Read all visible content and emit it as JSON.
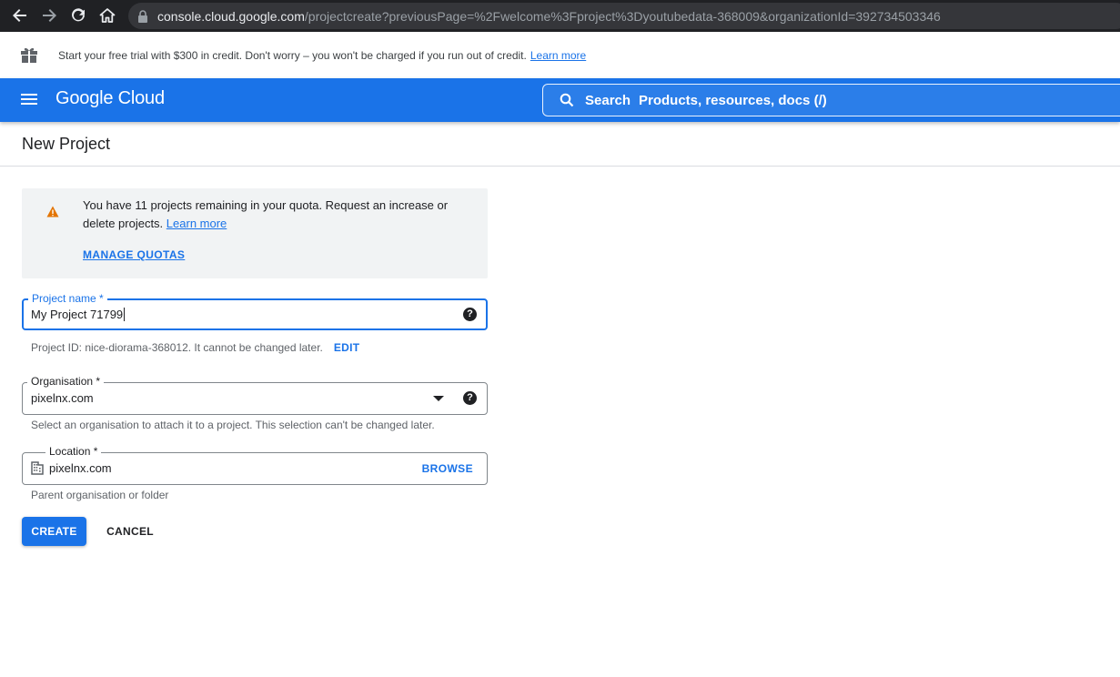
{
  "browser": {
    "url_host": "console.cloud.google.com",
    "url_path": "/projectcreate?previousPage=%2Fwelcome%3Fproject%3Dyoutubedata-368009&organizationId=392734503346"
  },
  "trial_banner": {
    "text": "Start your free trial with $300 in credit. Don't worry – you won't be charged if you run out of credit.",
    "link": "Learn more"
  },
  "header": {
    "logo": "Google Cloud",
    "search_label": "Search",
    "search_placeholder": "Products, resources, docs (/)"
  },
  "page": {
    "title": "New Project"
  },
  "quota_alert": {
    "text": "You have 11 projects remaining in your quota. Request an increase or delete projects.",
    "link": "Learn more",
    "manage_quotas": "MANAGE QUOTAS"
  },
  "form": {
    "project_name": {
      "label": "Project name *",
      "value": "My Project 71799",
      "helper": "Project ID: nice-diorama-368012. It cannot be changed later.",
      "edit": "EDIT"
    },
    "organisation": {
      "label": "Organisation *",
      "value": "pixelnx.com",
      "helper": "Select an organisation to attach it to a project. This selection can't be changed later."
    },
    "location": {
      "label": "Location *",
      "value": "pixelnx.com",
      "browse": "BROWSE",
      "helper": "Parent organisation or folder"
    }
  },
  "buttons": {
    "create": "CREATE",
    "cancel": "CANCEL"
  },
  "colors": {
    "brand_blue": "#1a73e8",
    "warning_orange": "#e37400"
  }
}
